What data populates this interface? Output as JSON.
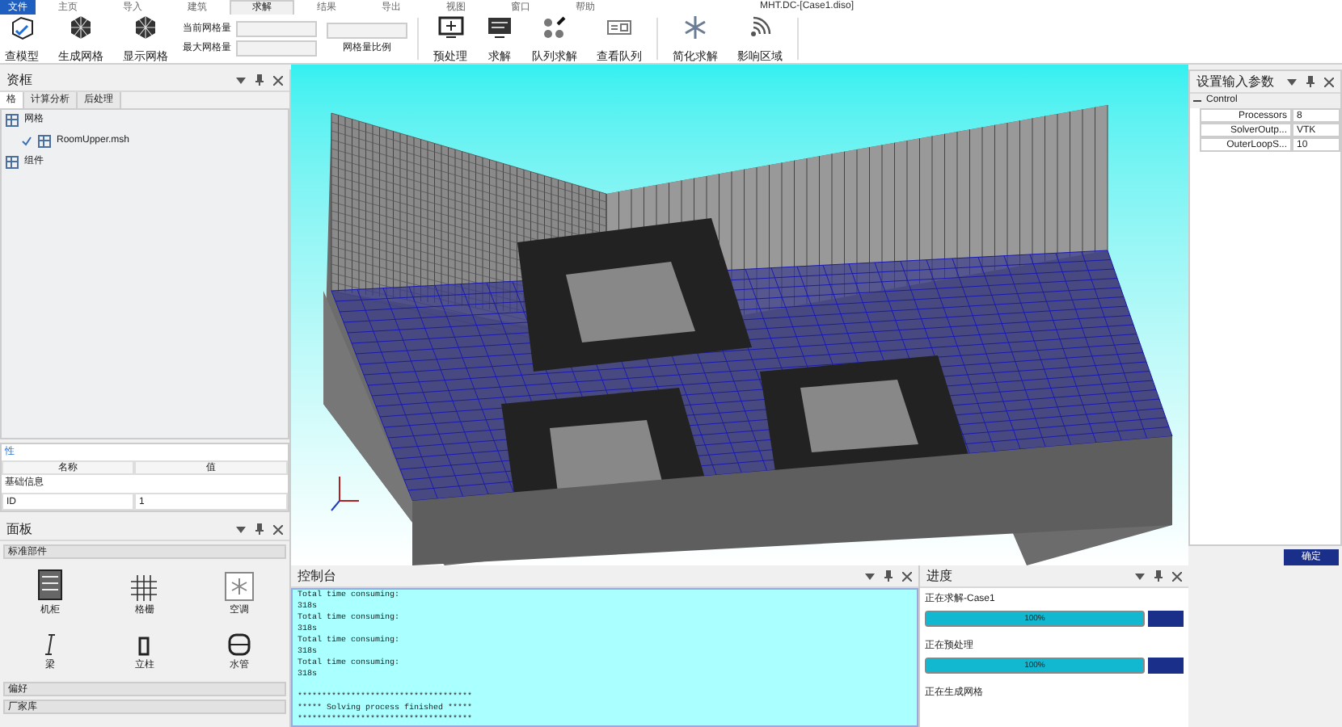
{
  "window": {
    "title": "MHT.DC-[Case1.diso]"
  },
  "menu_tabs": [
    {
      "label": "文件",
      "kind": "file",
      "selected": false
    },
    {
      "label": "主页",
      "kind": "tab",
      "selected": false
    },
    {
      "label": "导入",
      "kind": "tab",
      "selected": false
    },
    {
      "label": "建筑",
      "kind": "tab",
      "selected": false
    },
    {
      "label": "求解",
      "kind": "tab",
      "selected": true
    },
    {
      "label": "结果",
      "kind": "tab",
      "selected": false
    },
    {
      "label": "导出",
      "kind": "tab",
      "selected": false
    },
    {
      "label": "视图",
      "kind": "tab",
      "selected": false
    },
    {
      "label": "窗口",
      "kind": "tab",
      "selected": false
    },
    {
      "label": "帮助",
      "kind": "tab",
      "selected": false
    }
  ],
  "ribbon": {
    "mesh_buttons": [
      {
        "label": "查模型",
        "kind": "model"
      },
      {
        "label": "生成网格",
        "kind": "mesh"
      },
      {
        "label": "显示网格",
        "kind": "mesh"
      }
    ],
    "mesh_fields": [
      {
        "label": "当前网格量"
      },
      {
        "label": "最大网格量"
      }
    ],
    "ratio_label": "网格量比例",
    "solve_buttons": [
      {
        "label": "预处理",
        "kind": "monitor"
      },
      {
        "label": "求解",
        "kind": "screen"
      },
      {
        "label": "队列求解",
        "kind": "cluster"
      },
      {
        "label": "查看队列",
        "kind": "queue"
      }
    ],
    "extra_buttons": [
      {
        "label": "简化求解",
        "kind": "snow"
      },
      {
        "label": "影响区域",
        "kind": "signal"
      }
    ]
  },
  "resource_panel": {
    "title": "资框",
    "tabs": [
      {
        "label": "格",
        "selected": true
      },
      {
        "label": "计算分析",
        "selected": false
      },
      {
        "label": "后处理",
        "selected": false
      }
    ],
    "tree": [
      {
        "label": "网格",
        "children": [
          {
            "label": "RoomUpper.msh",
            "checked": true
          }
        ]
      },
      {
        "label": "组件"
      }
    ]
  },
  "property_panel": {
    "title": "性",
    "columns": [
      "名称",
      "值"
    ],
    "rows": [
      {
        "kind": "group",
        "name": "基础信息"
      },
      {
        "kind": "row",
        "name": "ID",
        "value": "1"
      }
    ]
  },
  "component_panel": {
    "title": "面板",
    "groups": [
      {
        "label": "标准部件",
        "items": [
          {
            "label": "机柜",
            "kind": "cabinet"
          },
          {
            "label": "格栅",
            "kind": "grid"
          },
          {
            "label": "空调",
            "kind": "ac"
          },
          {
            "label": "梁",
            "kind": "beam"
          },
          {
            "label": "立柱",
            "kind": "column"
          },
          {
            "label": "水管",
            "kind": "pipe"
          }
        ]
      },
      {
        "label": "偏好"
      },
      {
        "label": "厂家库"
      }
    ]
  },
  "console": {
    "title": "控制台",
    "lines": [
      "Total time consuming:",
      "318s",
      "Total time consuming:",
      "318s",
      "Total time consuming:",
      "318s",
      "Total time consuming:",
      "318s"
    ],
    "summary_lines": [
      "************************************",
      "***** Solving process finished *****",
      "************************************"
    ]
  },
  "settings_panel": {
    "title": "设置输入参数",
    "group": "Control",
    "expanded": true,
    "rows": [
      {
        "name": "Processors",
        "value": "8"
      },
      {
        "name": "SolverOutp...",
        "value": "VTK"
      },
      {
        "name": "OuterLoopS...",
        "value": "10"
      }
    ],
    "confirm": "确定"
  },
  "progress_panel": {
    "title": "进度",
    "tasks": [
      {
        "label": "正在求解-Case1",
        "level": 1,
        "reading": "100%"
      },
      {
        "label": "正在预处理",
        "level": 1,
        "reading": "100%"
      },
      {
        "label": "正在生成网格"
      }
    ]
  }
}
